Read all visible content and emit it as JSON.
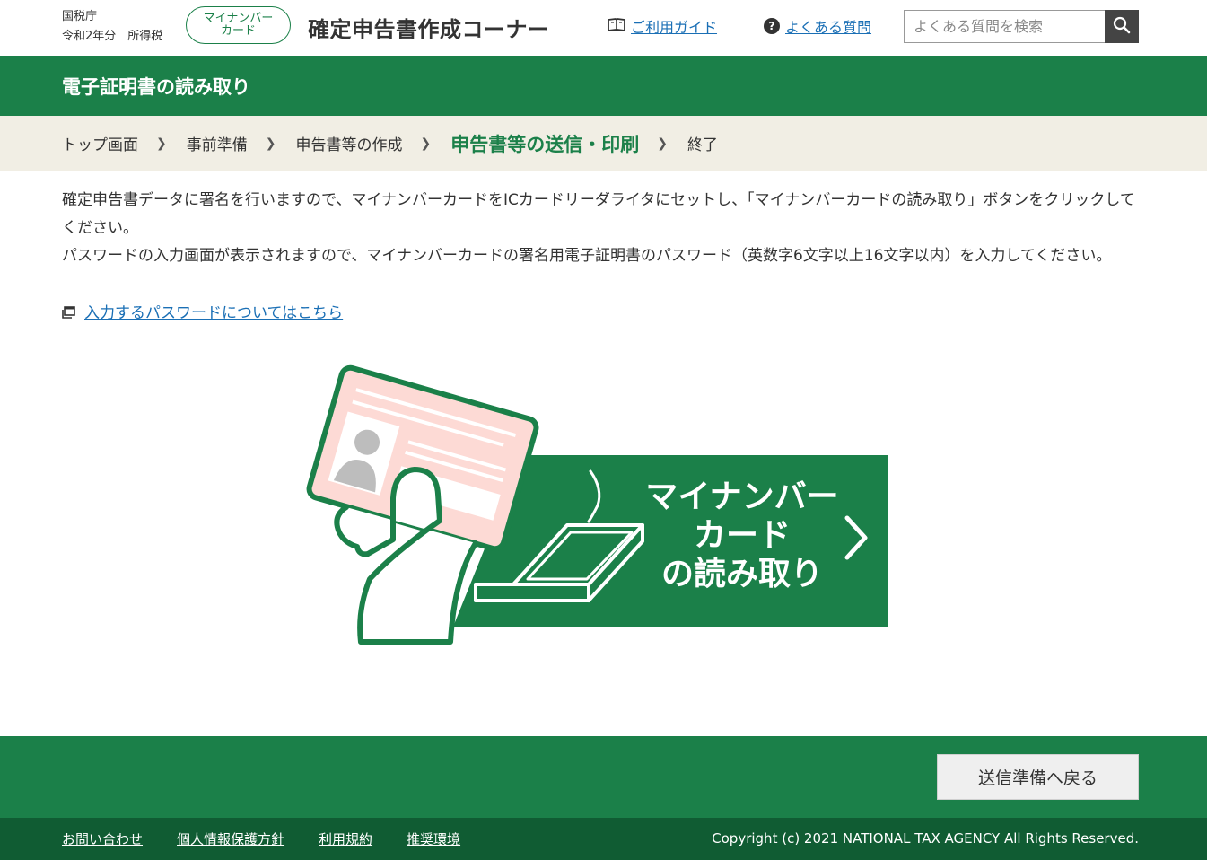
{
  "header": {
    "agency": "国税庁",
    "year_tax": "令和2年分　所得税",
    "badge_line1": "マイナンバー",
    "badge_line2": "カード",
    "site_title": "確定申告書作成コーナー",
    "guide_link": "ご利用ガイド",
    "faq_link": "よくある質問",
    "faq_icon_glyph": "?",
    "search_placeholder": "よくある質問を検索",
    "icons": [
      "book-icon",
      "question-icon",
      "search-icon"
    ]
  },
  "title_bar": {
    "title": "電子証明書の読み取り"
  },
  "breadcrumb": {
    "steps": [
      {
        "label": "トップ画面",
        "current": false
      },
      {
        "label": "事前準備",
        "current": false
      },
      {
        "label": "申告書等の作成",
        "current": false
      },
      {
        "label": "申告書等の送信・印刷",
        "current": true
      },
      {
        "label": "終了",
        "current": false
      }
    ],
    "separator": "❯"
  },
  "main": {
    "instruction_1": "確定申告書データに署名を行いますので、マイナンバーカードをICカードリーダライタにセットし、「マイナンバーカードの読み取り」ボタンをクリックしてください。",
    "instruction_2": "パスワードの入力画面が表示されますので、マイナンバーカードの署名用電子証明書のパスワード（英数字6文字以上16文字以内）を入力してください。",
    "password_link": "入力するパスワードについてはこちら",
    "reader_button": {
      "line1": "マイナンバー",
      "line2": "カード",
      "line3": "の読み取り"
    }
  },
  "footer": {
    "back_button": "送信準備へ戻る",
    "links": [
      "お問い合わせ",
      "個人情報保護方針",
      "利用規約",
      "推奨環境"
    ],
    "copyright": "Copyright (c) 2021 NATIONAL TAX AGENCY All Rights Reserved."
  },
  "colors": {
    "brand_green": "#1b8049",
    "footer_dark_green": "#105c33",
    "breadcrumb_bg": "#f1eee4",
    "link_blue": "#1a6fb5",
    "card_pink": "#fddad5"
  }
}
